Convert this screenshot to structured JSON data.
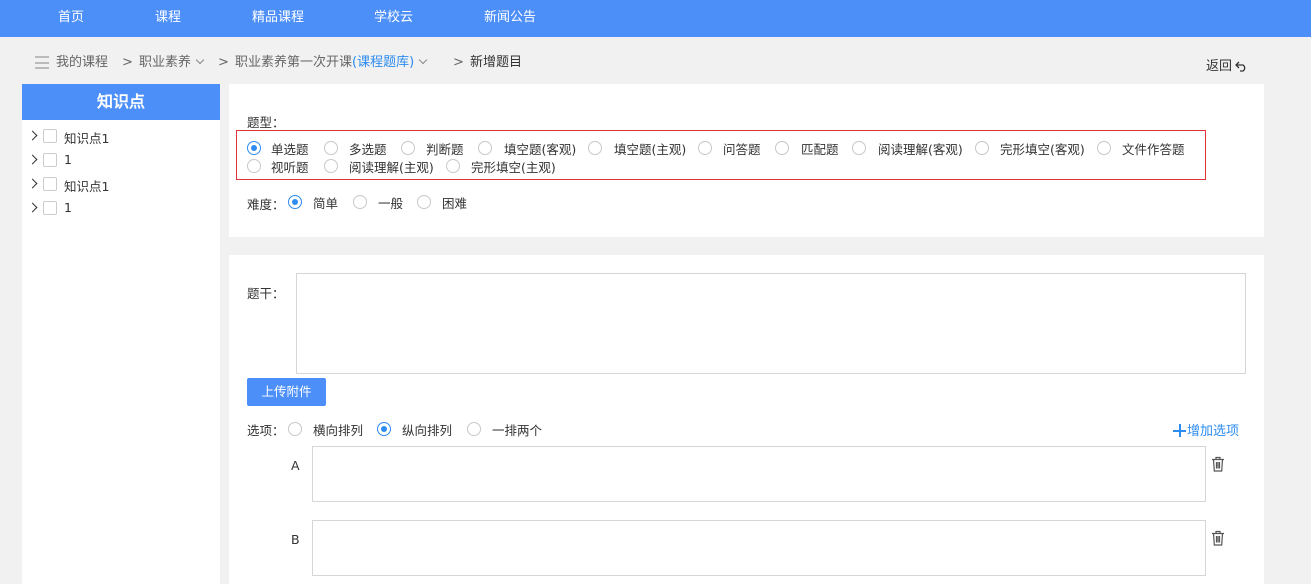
{
  "topnav": {
    "items": [
      "首页",
      "课程",
      "精品课程",
      "学校云",
      "新闻公告"
    ]
  },
  "breadcrumb": {
    "my_courses": "我的课程",
    "sep": ">",
    "course": "职业素养",
    "class_name": "职业素养第一次开课",
    "library": "(课程题库)",
    "current": "新增题目",
    "back": "返回"
  },
  "sidebar": {
    "title": "知识点",
    "items": [
      {
        "label": "知识点1"
      },
      {
        "label": "1"
      },
      {
        "label": "知识点1"
      },
      {
        "label": "1"
      }
    ]
  },
  "question_type": {
    "label": "题型：",
    "options": [
      "单选题",
      "多选题",
      "判断题",
      "填空题(客观)",
      "填空题(主观)",
      "问答题",
      "匹配题",
      "阅读理解(客观)",
      "完形填空(客观)",
      "文件作答题",
      "视听题",
      "阅读理解(主观)",
      "完形填空(主观)"
    ],
    "selected": "单选题"
  },
  "difficulty": {
    "label": "难度：",
    "options": [
      "简单",
      "一般",
      "困难"
    ],
    "selected": "简单"
  },
  "stem": {
    "label": "题干："
  },
  "upload_button": "上传附件",
  "options_section": {
    "label": "选项：",
    "layouts": [
      "横向排列",
      "纵向排列",
      "一排两个"
    ],
    "selected": "纵向排列",
    "add_label": "增加选项",
    "choices": [
      {
        "letter": "A"
      },
      {
        "letter": "B"
      }
    ]
  },
  "colors": {
    "primary": "#4d8ff8",
    "link": "#2d8cf0",
    "highlight_border": "#e0343a"
  }
}
